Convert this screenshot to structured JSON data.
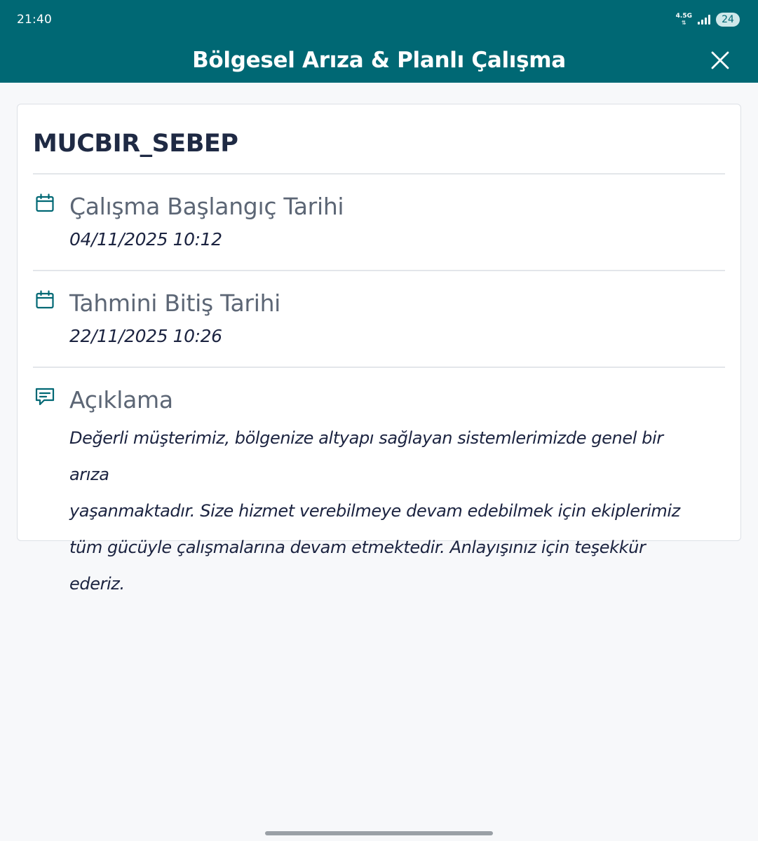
{
  "status_bar": {
    "time": "21:40",
    "network": "4.5G",
    "battery": "24"
  },
  "app_bar": {
    "title": "Bölgesel Arıza & Planlı Çalışma",
    "close_icon": "close-icon"
  },
  "card": {
    "title": "MUCBIR_SEBEP",
    "start": {
      "icon": "calendar-icon",
      "label": "Çalışma Başlangıç Tarihi",
      "value": "04/11/2025 10:12"
    },
    "end": {
      "icon": "calendar-icon",
      "label": "Tahmini Bitiş Tarihi",
      "value": "22/11/2025 10:26"
    },
    "description": {
      "icon": "comment-icon",
      "label": "Açıklama",
      "lines": [
        "Değerli müşterimiz, bölgenize altyapı sağlayan sistemlerimizde genel bir arıza",
        "yaşanmaktadır. Size hizmet verebilmeye devam edebilmek için ekiplerimiz",
        "tüm gücüyle çalışmalarına devam etmektedir. Anlayışınız için teşekkür ederiz."
      ]
    }
  },
  "colors": {
    "primary": "#006874",
    "title_text": "#1f2a44",
    "label_text": "#5c6675",
    "value_text": "#1b2340"
  }
}
